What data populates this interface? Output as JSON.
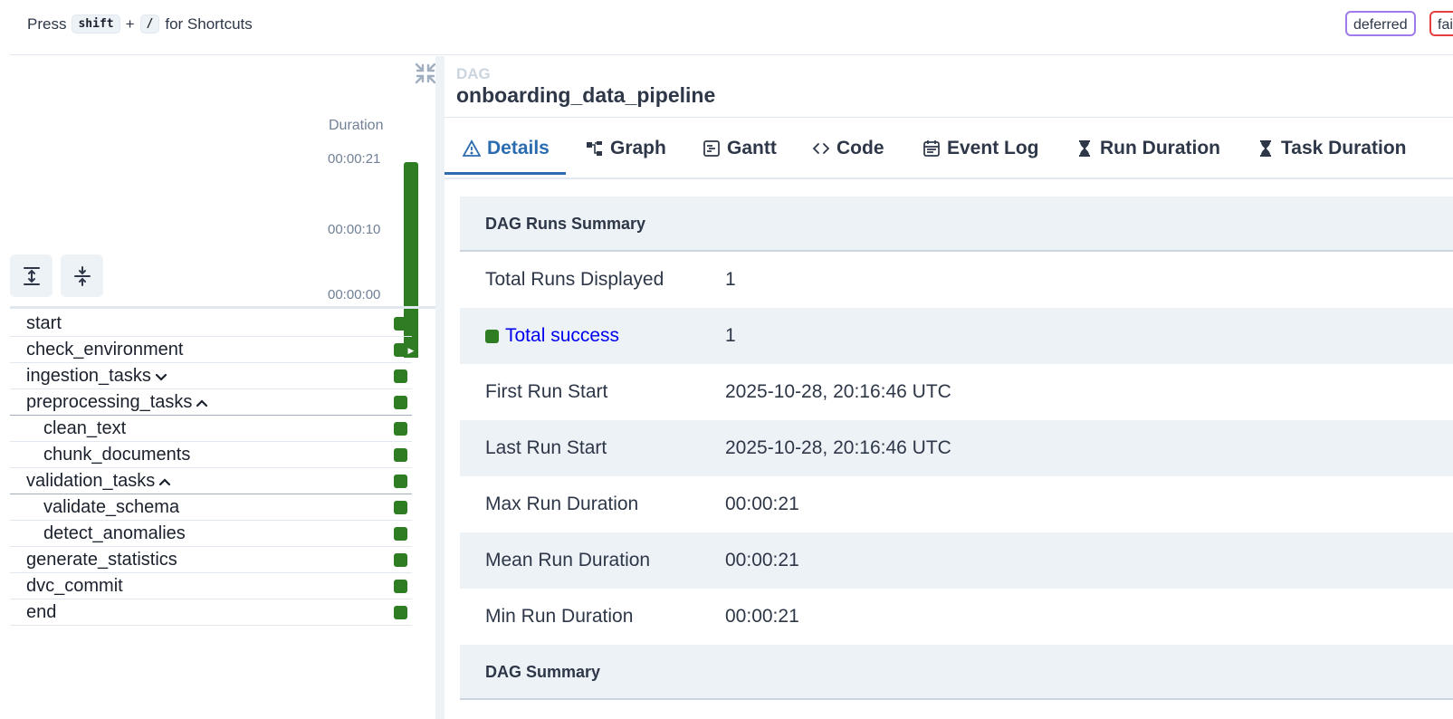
{
  "topbar": {
    "press": "Press",
    "key1": "shift",
    "plus": "+",
    "key2": "/",
    "for_shortcuts": "for Shortcuts",
    "badges": [
      "deferred",
      "failed"
    ]
  },
  "grid": {
    "duration_label": "Duration",
    "ticks": [
      "00:00:21",
      "00:00:10",
      "00:00:00"
    ],
    "run_bar": {
      "duration_seconds": 21,
      "max_seconds": 21,
      "state": "success"
    },
    "tasks": [
      {
        "name": "start",
        "level": 0,
        "group": null
      },
      {
        "name": "check_environment",
        "level": 0,
        "group": null
      },
      {
        "name": "ingestion_tasks",
        "level": 0,
        "group": "collapsed"
      },
      {
        "name": "preprocessing_tasks",
        "level": 0,
        "group": "expanded"
      },
      {
        "name": "clean_text",
        "level": 1,
        "group": null
      },
      {
        "name": "chunk_documents",
        "level": 1,
        "group": null
      },
      {
        "name": "validation_tasks",
        "level": 0,
        "group": "expanded"
      },
      {
        "name": "validate_schema",
        "level": 1,
        "group": null
      },
      {
        "name": "detect_anomalies",
        "level": 1,
        "group": null
      },
      {
        "name": "generate_statistics",
        "level": 0,
        "group": null
      },
      {
        "name": "dvc_commit",
        "level": 0,
        "group": null
      },
      {
        "name": "end",
        "level": 0,
        "group": null
      }
    ]
  },
  "dag": {
    "label": "DAG",
    "name": "onboarding_data_pipeline"
  },
  "tabs": [
    "Details",
    "Graph",
    "Gantt",
    "Code",
    "Event Log",
    "Run Duration",
    "Task Duration"
  ],
  "summary": {
    "runs_heading": "DAG Runs Summary",
    "rows": [
      {
        "label": "Total Runs Displayed",
        "value": "1"
      },
      {
        "label": "Total success",
        "value": "1"
      },
      {
        "label": "First Run Start",
        "value": "2025-10-28, 20:16:46 UTC"
      },
      {
        "label": "Last Run Start",
        "value": "2025-10-28, 20:16:46 UTC"
      },
      {
        "label": "Max Run Duration",
        "value": "00:00:21"
      },
      {
        "label": "Mean Run Duration",
        "value": "00:00:21"
      },
      {
        "label": "Min Run Duration",
        "value": "00:00:21"
      }
    ],
    "dag_heading": "DAG Summary"
  },
  "colors": {
    "success": "#2f7d23",
    "accent": "#2b6cb0",
    "deferred": "#9f7aea",
    "failed": "#e53e3e"
  }
}
